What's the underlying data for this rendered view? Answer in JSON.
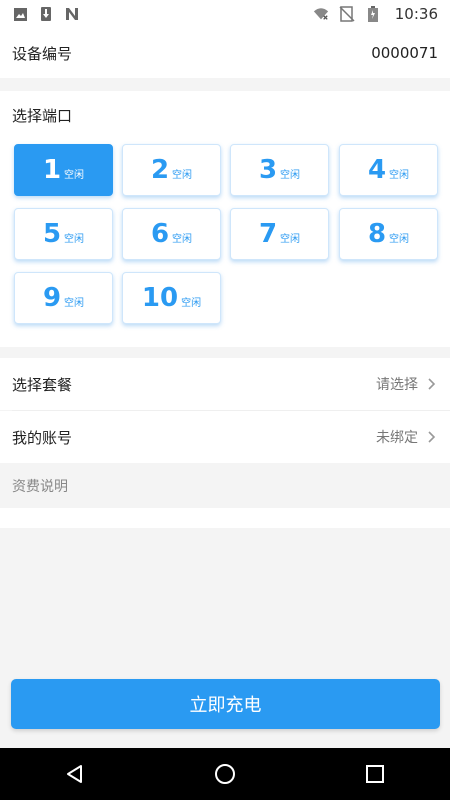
{
  "status_bar": {
    "time": "10:36",
    "left_icons": [
      "image-icon",
      "download-icon",
      "n-notification-icon"
    ],
    "right_icons": [
      "wifi-off-icon",
      "no-signal-icon",
      "battery-icon"
    ]
  },
  "device": {
    "label": "设备编号",
    "value": "0000071"
  },
  "ports": {
    "title": "选择端口",
    "items": [
      {
        "number": "1",
        "status": "空闲",
        "selected": true
      },
      {
        "number": "2",
        "status": "空闲",
        "selected": false
      },
      {
        "number": "3",
        "status": "空闲",
        "selected": false
      },
      {
        "number": "4",
        "status": "空闲",
        "selected": false
      },
      {
        "number": "5",
        "status": "空闲",
        "selected": false
      },
      {
        "number": "6",
        "status": "空闲",
        "selected": false
      },
      {
        "number": "7",
        "status": "空闲",
        "selected": false
      },
      {
        "number": "8",
        "status": "空闲",
        "selected": false
      },
      {
        "number": "9",
        "status": "空闲",
        "selected": false
      },
      {
        "number": "10",
        "status": "空闲",
        "selected": false
      }
    ]
  },
  "package": {
    "label": "选择套餐",
    "value": "请选择"
  },
  "account": {
    "label": "我的账号",
    "value": "未绑定"
  },
  "fee": {
    "label": "资费说明"
  },
  "charge_button": {
    "label": "立即充电"
  },
  "colors": {
    "accent": "#2a9af2",
    "background": "#f4f4f4"
  },
  "nav_bar": {
    "icons": [
      "back-triangle-icon",
      "home-circle-icon",
      "recents-square-icon"
    ]
  }
}
